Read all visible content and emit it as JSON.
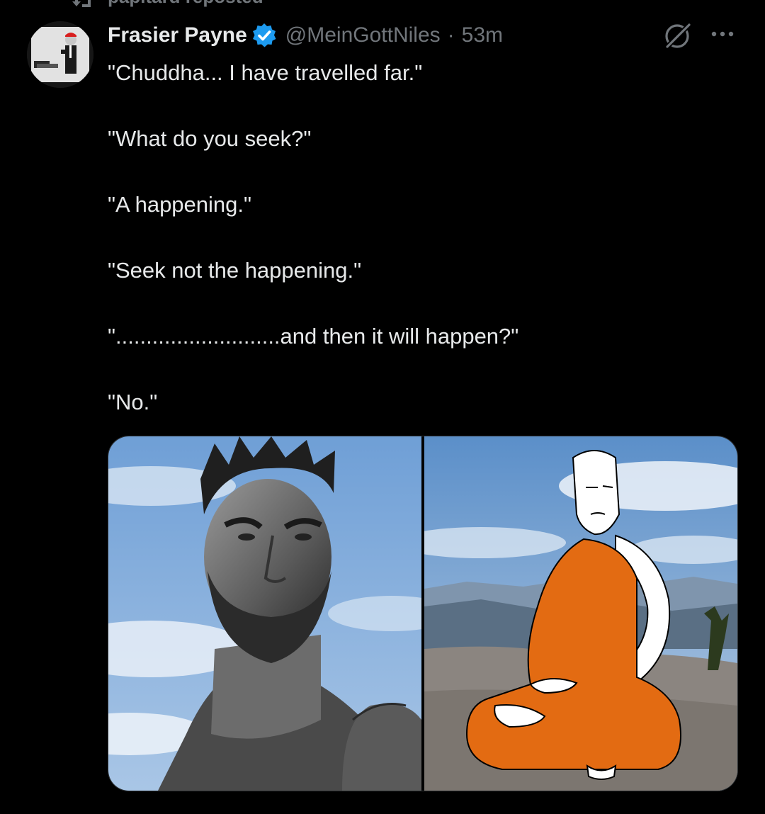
{
  "repost": {
    "text": "papitard reposted",
    "icon": "repost-icon"
  },
  "tweet": {
    "display_name": "Frasier Payne",
    "verified": true,
    "handle": "@MeinGottNiles",
    "separator": "·",
    "time": "53m",
    "lines": [
      "\"Chuddha... I have travelled far.\"",
      "\"What do you seek?\"",
      "\"A happening.\"",
      "\"Seek not the happening.\"",
      "\"...........................and then it will happen?\"",
      "\"No.\""
    ]
  },
  "icons": {
    "verified": "verified-badge-icon",
    "grok": "grok-icon",
    "more": "more-options-icon"
  },
  "colors": {
    "background": "#000000",
    "text": "#e7e9ea",
    "secondary": "#71767b",
    "verified": "#1d9bf0",
    "robe": "#e36b12",
    "sky": "#5b8fc9"
  }
}
